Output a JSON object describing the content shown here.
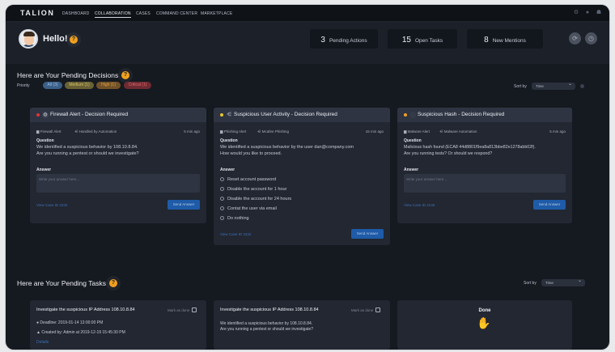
{
  "app": {
    "logo": "TALION"
  },
  "nav": [
    "DASHBOARD",
    "COLLABORATION",
    "CASES",
    "COMMAND CENTER",
    "MARKETPLACE"
  ],
  "nav_active": "COLLABORATION",
  "greeting": "Hello!",
  "stats": {
    "pending_actions": {
      "value": "3",
      "label": "Pending Actions"
    },
    "open_tasks": {
      "value": "15",
      "label": "Open Tasks"
    },
    "new_mentions": {
      "value": "8",
      "label": "New Mentions"
    }
  },
  "decisions": {
    "title": "Here are Your Pending Decisions",
    "priority_label": "Priority",
    "chips": [
      "All (3)",
      "Medium (1)",
      "High (1)",
      "Critical (1)"
    ],
    "sort_label": "Sort by",
    "sort_value": "Time",
    "cards": [
      {
        "title": "Firewall Alert - Decision Required",
        "meta1": "Firewall Alert",
        "meta2": "Handled by Automation",
        "time": "5 min ago",
        "question_label": "Question",
        "question": "We identified a suspicious behavior by 108.10.8.84.",
        "question2": "Are you running a pentest or should we investigate?",
        "answer_label": "Answer",
        "answer_placeholder": "Write your answer here...",
        "view_link": "View Case ID 2232",
        "send_label": "Send Answer"
      },
      {
        "title": "Suspicious User Activity - Decision Required",
        "meta1": "Phishing Alert",
        "meta2": "Mcafee Phishing",
        "time": "15 min ago",
        "question_label": "Question",
        "question": "We identified a suspicious behavior by the user dan@company.com",
        "question2": "How would you like to proceed.",
        "answer_label": "Answer",
        "options": [
          "Reset account password",
          "Disable the account for 1 hour",
          "Disable the account for 24 hours",
          "Contat the user via email",
          "Do nothing"
        ],
        "view_link": "View Case ID 2232",
        "send_label": "Send Answer"
      },
      {
        "title": "Suspicious Hash - Decision Required",
        "meta1": "Malware Alert",
        "meta2": "Malware Automation",
        "time": "5 min ago",
        "question_label": "Question",
        "question": "Malicious hash found (ECA8 44d8801f9ea8a813bbe82e1278abb02f).",
        "question2": "Are you running tests? Or should we respond?",
        "answer_label": "Answer",
        "answer_placeholder": "Write your answer here...",
        "view_link": "View Case ID 2245",
        "send_label": "Send Answer"
      }
    ]
  },
  "tasks": {
    "title": "Here are Your Pending Tasks",
    "sort_label": "Sort by",
    "sort_value": "Time",
    "cards": [
      {
        "title": "Investigate the suspicious IP Address 108.10.8.84",
        "mark": "Mark as done",
        "deadline": "Deadline: 2019-01-14 13:00:00 PM",
        "created": "Created by: Admin at 2019-12-19 15:45:30 PM",
        "link": "Details"
      },
      {
        "title": "Investigate the suspicious IP Address 108.10.8.84",
        "mark": "Mark as done",
        "line1": "We identified a suspicious behavior by 108.10.8.84.",
        "line2": "Are you running a pentest or should we investigate?"
      },
      {
        "done": "Done"
      }
    ]
  },
  "colors": {
    "accent": "#f0a020",
    "critical": "#e0343b",
    "medium": "#c9a93a",
    "link": "#3e6fb3"
  }
}
